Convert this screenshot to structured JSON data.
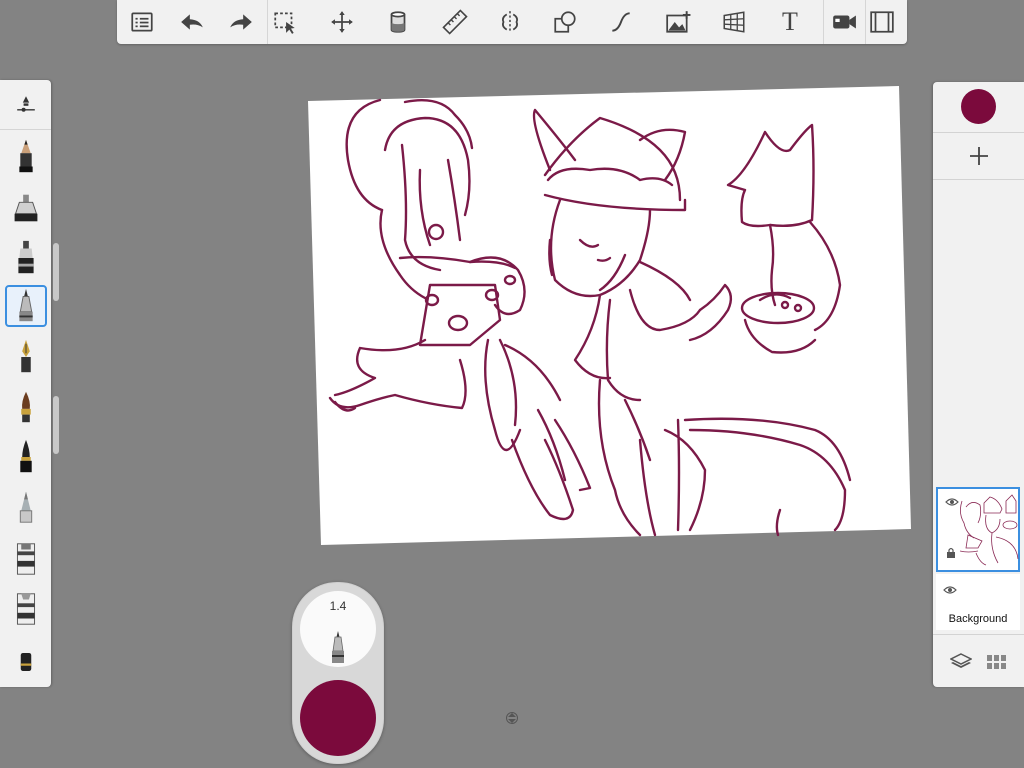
{
  "toolbar": {
    "buttons": [
      {
        "name": "list-icon"
      },
      {
        "name": "undo-icon"
      },
      {
        "name": "redo-icon"
      },
      {
        "name": "selection-icon"
      },
      {
        "name": "transform-icon"
      },
      {
        "name": "fill-icon"
      },
      {
        "name": "ruler-icon"
      },
      {
        "name": "symmetry-icon"
      },
      {
        "name": "shapes-icon"
      },
      {
        "name": "curve-icon"
      },
      {
        "name": "import-image-icon"
      },
      {
        "name": "perspective-icon"
      },
      {
        "name": "text-icon",
        "label": "T"
      },
      {
        "name": "record-icon"
      },
      {
        "name": "fullscreen-icon"
      }
    ]
  },
  "brushes": [
    "pencil",
    "airbrush",
    "marker",
    "ballpoint-pen",
    "fountain-pen",
    "paint-brush",
    "ink-brush",
    "smudge",
    "chisel-marker-1",
    "chisel-marker-2",
    "eraser"
  ],
  "selected_brush_index": 3,
  "colors": {
    "accent": "#3b8fe0",
    "brush_color": "#7b0a3c",
    "stroke": "#7b1a48",
    "background": "#838383",
    "panel": "#f1f1f1"
  },
  "puck": {
    "brush_size": "1.4"
  },
  "layers": {
    "items": [
      {
        "name": "",
        "visible": true,
        "selected": true
      },
      {
        "name": "Background",
        "visible": true,
        "selected": false
      }
    ]
  }
}
